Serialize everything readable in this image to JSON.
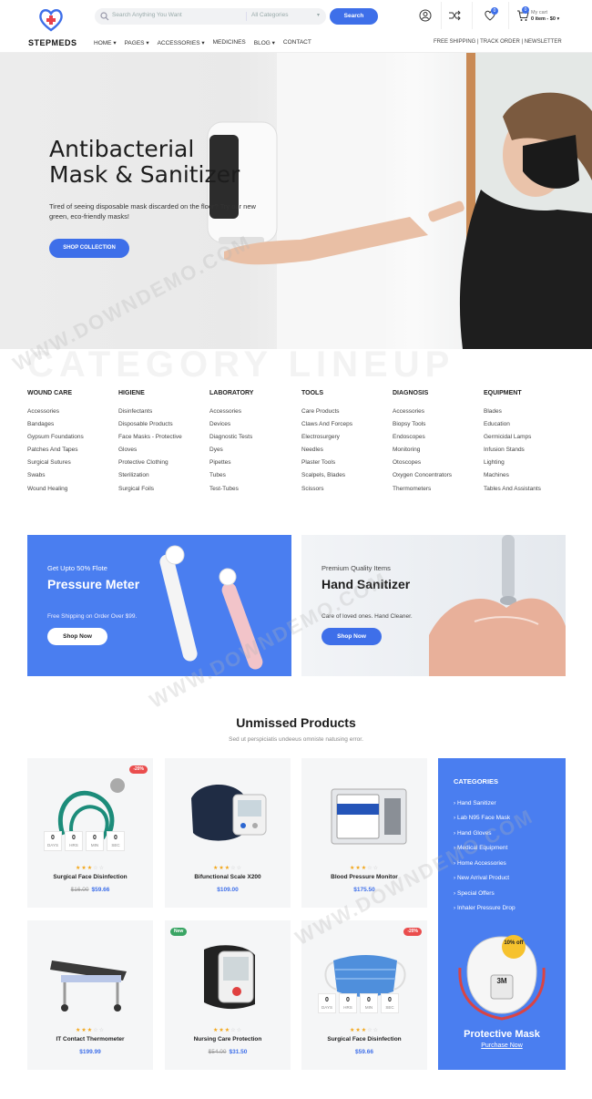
{
  "brand": {
    "name": "STEPMEDS",
    "accent": "#3e6fe9"
  },
  "header": {
    "search_placeholder": "Search Anything You Want",
    "category_select": "All Categories",
    "search_button": "Search",
    "wishlist_count": "0",
    "cart_count": "0",
    "cart_label": "My cart",
    "cart_summary": "0 item - $0"
  },
  "nav": {
    "items": [
      "HOME",
      "PAGES",
      "ACCESSORIES",
      "MEDICINES",
      "BLOG",
      "CONTACT"
    ],
    "right": [
      "FREE SHIPPING",
      "TRACK ORDER",
      "NEWSLETTER"
    ]
  },
  "hero": {
    "title": "Antibacterial\nMask & Sanitizer",
    "subtitle": "Tired of seeing disposable mask discarded on the floor? Try our new green, eco-friendly masks!",
    "button": "SHOP COLLECTION"
  },
  "category_lineup": {
    "watermark": "CATEGORY LINEUP",
    "columns": [
      {
        "title": "WOUND CARE",
        "items": [
          "Accessories",
          "Bandages",
          "Gypsum Foundations",
          "Patches And Tapes",
          "Surgical Sutures",
          "Swabs",
          "Wound Healing"
        ]
      },
      {
        "title": "HIGIENE",
        "items": [
          "Disinfectants",
          "Disposable Products",
          "Face Masks - Protective",
          "Gloves",
          "Protective Clothing",
          "Sterilization",
          "Surgical Foils"
        ]
      },
      {
        "title": "LABORATORY",
        "items": [
          "Accessories",
          "Devices",
          "Diagnostic Tests",
          "Dyes",
          "Pipettes",
          "Tubes",
          "Test-Tubes"
        ]
      },
      {
        "title": "TOOLS",
        "items": [
          "Care Products",
          "Claws And Forceps",
          "Electrosurgery",
          "Needles",
          "Plaster Tools",
          "Scalpels, Blades",
          "Scissors"
        ]
      },
      {
        "title": "DIAGNOSIS",
        "items": [
          "Accessories",
          "Biopsy Tools",
          "Endoscopes",
          "Monitoring",
          "Otoscopes",
          "Oxygen Concentrators",
          "Thermometers"
        ]
      },
      {
        "title": "EQUIPMENT",
        "items": [
          "Blades",
          "Education",
          "Germicidal Lamps",
          "Infusion Stands",
          "Lighting",
          "Machines",
          "Tables And Assistants"
        ]
      }
    ]
  },
  "promos": [
    {
      "kicker": "Get Upto 50% Flote",
      "title": "Pressure Meter",
      "text": "Free Shipping on Order Over $99.",
      "button": "Shop Now"
    },
    {
      "kicker": "Premium Quality Items",
      "title": "Hand Sanitizer",
      "text": "Care of loved ones. Hand Cleaner.",
      "button": "Shop Now"
    }
  ],
  "products_section": {
    "title": "Unmissed Products",
    "subtitle": "Sed ut perspiciatis undeeus omniste natusing error.",
    "countdown_labels": [
      "DAYS",
      "HRS",
      "MIN",
      "SEC"
    ],
    "countdown_values": [
      "0",
      "0",
      "0",
      "0"
    ],
    "products": [
      {
        "name": "Surgical Face Disinfection",
        "old_price": "$16.00",
        "price": "$59.66",
        "tag": "-20%",
        "rating": 3
      },
      {
        "name": "Bifunctional Scale X200",
        "old_price": "",
        "price": "$109.00",
        "tag": "",
        "rating": 3
      },
      {
        "name": "Blood Pressure Monitor",
        "old_price": "",
        "price": "$175.50",
        "tag": "",
        "rating": 3
      },
      {
        "name": "IT Contact Thermometer",
        "old_price": "",
        "price": "$199.99",
        "tag": "",
        "rating": 3
      },
      {
        "name": "Nursing Care Protection",
        "old_price": "$54.00",
        "price": "$31.50",
        "tag": "New",
        "rating": 3
      },
      {
        "name": "Surgical Face Disinfection",
        "old_price": "",
        "price": "$59.66",
        "tag": "-20%",
        "rating": 3
      }
    ]
  },
  "sidebar": {
    "title": "CATEGORIES",
    "items": [
      "Hand Sanitizer",
      "Lab N95 Face Mask",
      "Hand Gloves",
      "Medical Equipment",
      "Home Accessories",
      "New Arrival Product",
      "Special Offers",
      "Inhaler Pressure Drop"
    ],
    "ad_badge": "10% off",
    "ad_brand": "3M",
    "ad_title": "Protective Mask",
    "ad_link": "Purchase Now"
  },
  "watermark_text": "WWW.DOWNDEMO.COM"
}
